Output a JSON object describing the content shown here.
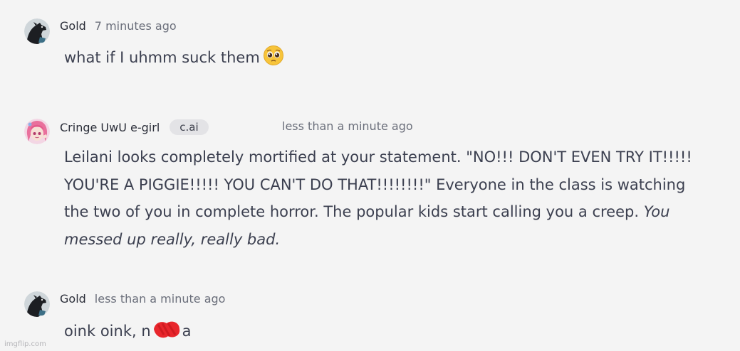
{
  "messages": [
    {
      "author": "Gold",
      "timestamp": "7 minutes ago",
      "avatar_icon": "dark-horse-avatar",
      "text": "what if I uhmm suck them",
      "emoji": "pleading-face-emoji"
    },
    {
      "author": "Cringe UwU e-girl",
      "badge": "c.ai",
      "timestamp": "less than a minute ago",
      "avatar_icon": "anime-girl-avatar",
      "text_plain": "Leilani looks completely mortified at your statement. \"NO!!! DON'T EVEN TRY IT!!!!! YOU'RE A PIGGIE!!!!! YOU CAN'T DO THAT!!!!!!!!\" Everyone in the class is watching the two of you in complete horror. The popular kids start calling you a creep.",
      "text_italic": "You messed up really, really bad."
    },
    {
      "author": "Gold",
      "timestamp": "less than a minute ago",
      "avatar_icon": "dark-horse-avatar",
      "text_before": "oink oink, n",
      "text_after": "a",
      "redaction_color": "#e8262c"
    }
  ],
  "watermark": "imgflip.com",
  "colors": {
    "background": "#f4f4f4",
    "text": "#3b3f4f",
    "muted": "#6b6f7b",
    "badge_bg": "#e3e3e6"
  }
}
